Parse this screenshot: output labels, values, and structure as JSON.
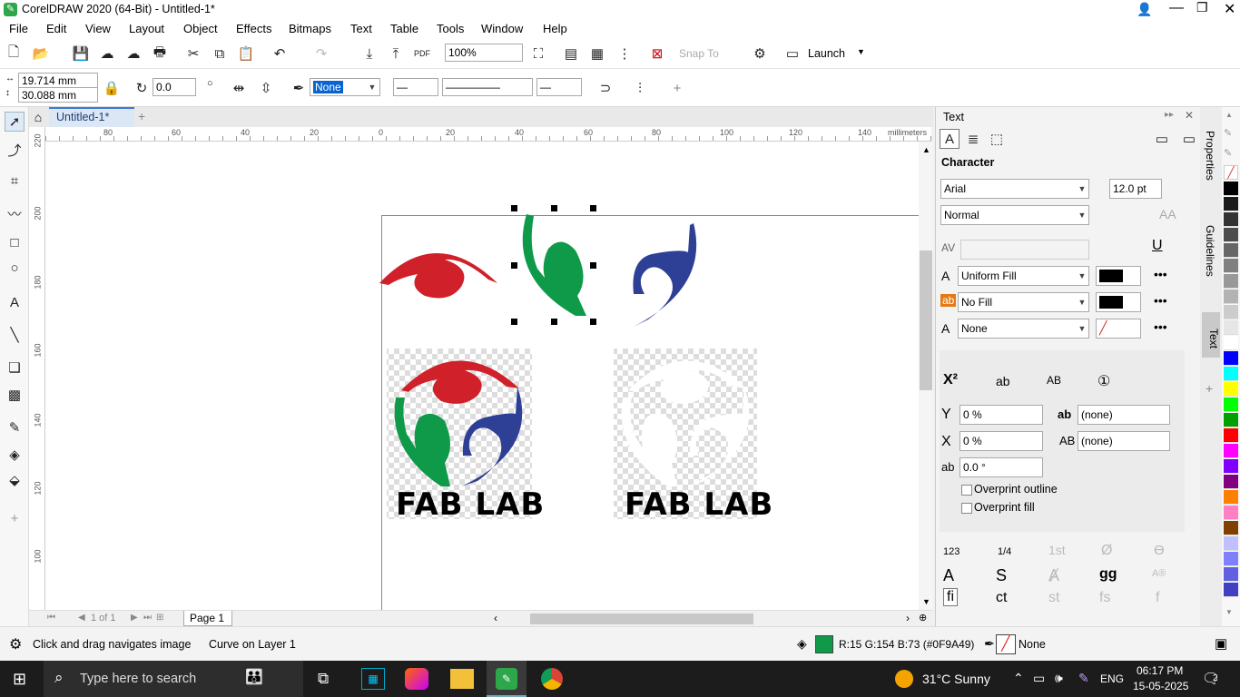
{
  "app": {
    "title": "CorelDRAW 2020 (64-Bit) - Untitled-1*"
  },
  "menu": [
    "File",
    "Edit",
    "View",
    "Layout",
    "Object",
    "Effects",
    "Bitmaps",
    "Text",
    "Table",
    "Tools",
    "Window",
    "Help"
  ],
  "toolbar": {
    "zoom": "100%",
    "snap_to": "Snap To",
    "launch": "Launch"
  },
  "propbar": {
    "width": "19.714 mm",
    "height": "30.088 mm",
    "rotation": "0.0",
    "outline_start": "None"
  },
  "document": {
    "tab": "Untitled-1*",
    "page_label": "Page 1",
    "page_counter": "1 of 1"
  },
  "ruler": {
    "units": "millimeters",
    "h_ticks": [
      "80",
      "60",
      "40",
      "20",
      "0",
      "20",
      "40",
      "60",
      "80",
      "100",
      "120",
      "140"
    ],
    "v_ticks": [
      "220",
      "200",
      "180",
      "160",
      "140",
      "120",
      "100"
    ]
  },
  "canvas": {
    "logo_text_1": "FAB LAB",
    "logo_text_2": "FAB LAB",
    "colors": {
      "red": "#d0202a",
      "green": "#0f9a49",
      "blue": "#2e3f96"
    }
  },
  "docker": {
    "title": "Text",
    "section": "Character",
    "font": "Arial",
    "size": "12.0 pt",
    "style": "Normal",
    "fill": "Uniform Fill",
    "bg_fill": "No Fill",
    "outline": "None",
    "baseline": "0 %",
    "horizontal": "0 %",
    "angle": "0.0 °",
    "pos1": "(none)",
    "pos2": "(none)",
    "overprint_outline": "Overprint outline",
    "overprint_fill": "Overprint fill",
    "side_tabs": [
      "Properties",
      "Guidelines",
      "Text"
    ]
  },
  "status": {
    "hint": "Click and drag navigates image",
    "object": "Curve on Layer 1",
    "fill_info": "R:15 G:154 B:73 (#0F9A49)",
    "outline_info": "None"
  },
  "taskbar": {
    "search": "Type here to search",
    "weather": "31°C  Sunny",
    "lang": "ENG",
    "time": "06:17 PM",
    "date": "15-05-2025",
    "notif": "2"
  },
  "palette": [
    "#000000",
    "#1a1a1a",
    "#333333",
    "#4d4d4d",
    "#666666",
    "#808080",
    "#999999",
    "#b3b3b3",
    "#cccccc",
    "#e6e6e6",
    "#ffffff",
    "#0000ff",
    "#00ffff",
    "#ffff00",
    "#00ff00",
    "#00a000",
    "#ff0000",
    "#ff00ff",
    "#8000ff",
    "#800080",
    "#ff8000",
    "#ff80c0",
    "#804000",
    "#c0c0ff",
    "#8080ff",
    "#6060e0",
    "#4040c0"
  ]
}
